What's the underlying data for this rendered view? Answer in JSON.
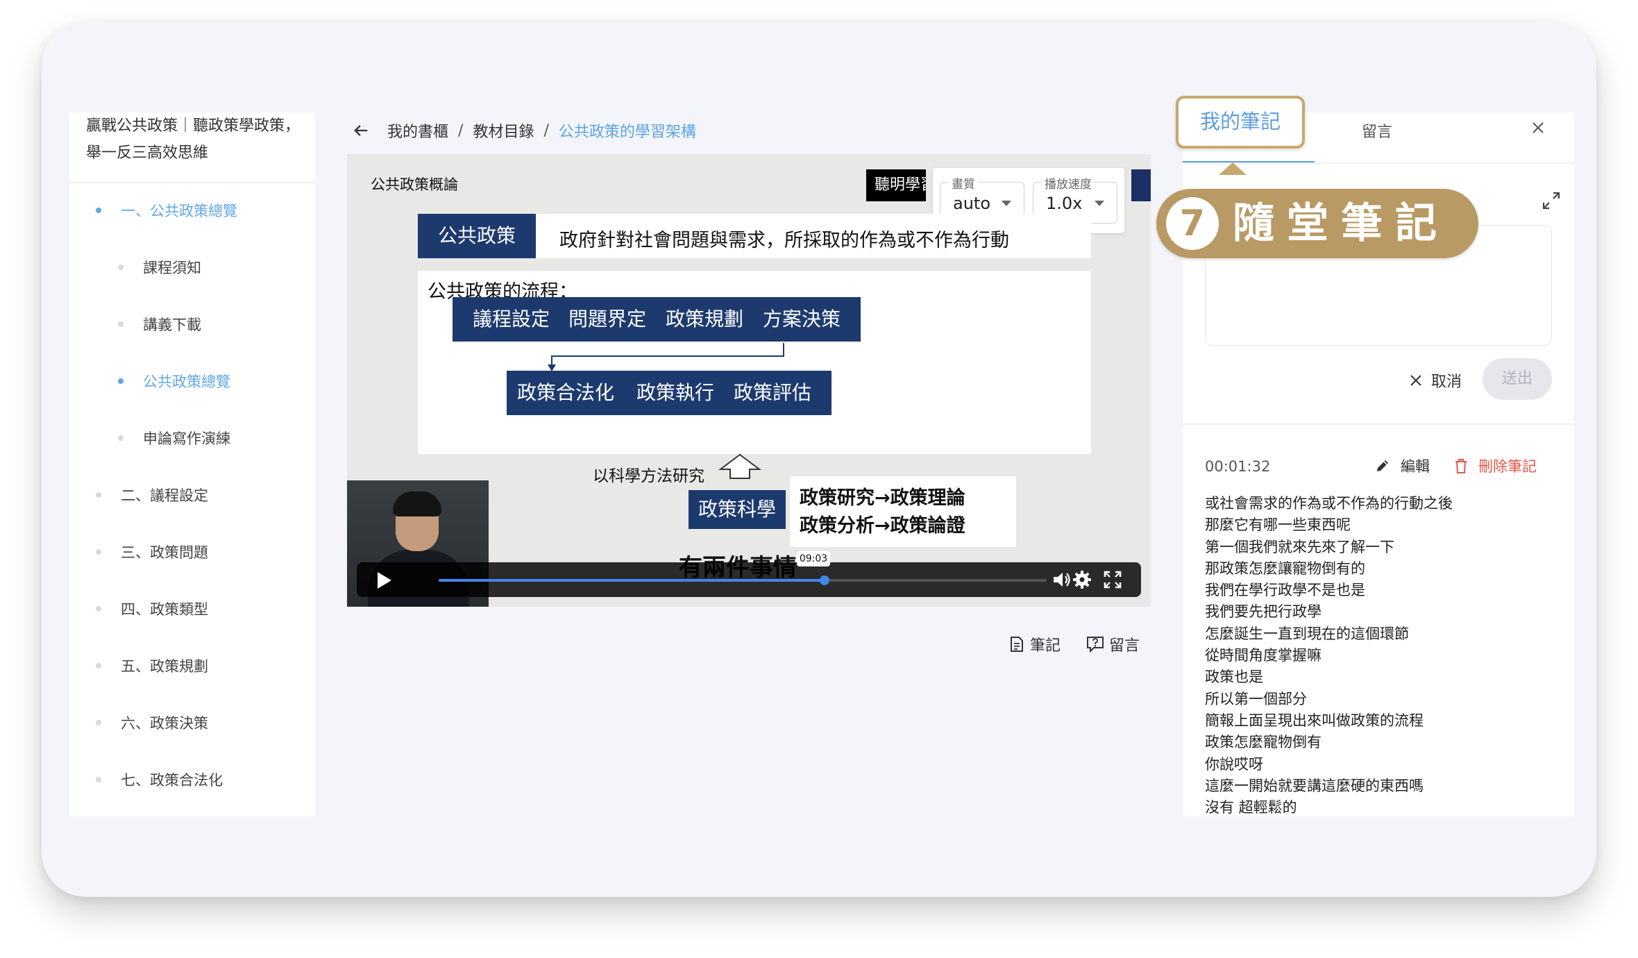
{
  "colors": {
    "accent": "#5b9ee0",
    "badge": "#b99a65",
    "navy": "#1c3a6e",
    "danger": "#e2574c"
  },
  "sidebar": {
    "course_title": "贏戰公共政策｜聽政策學政策，舉一反三高效思維",
    "items": [
      {
        "label": "一、公共政策總覽",
        "active": true
      },
      {
        "label": "課程須知"
      },
      {
        "label": "講義下載"
      },
      {
        "label": "公共政策總覽",
        "active": true
      },
      {
        "label": "申論寫作演練"
      },
      {
        "label": "二、議程設定"
      },
      {
        "label": "三、政策問題"
      },
      {
        "label": "四、政策類型"
      },
      {
        "label": "五、政策規劃"
      },
      {
        "label": "六、政策決策"
      },
      {
        "label": "七、政策合法化"
      }
    ]
  },
  "breadcrumb": {
    "items": [
      "我的書櫃",
      "教材目錄",
      "公共政策的學習架構"
    ],
    "separator": "/"
  },
  "video": {
    "slide_header": "公共政策概論",
    "brand": "聽明學習",
    "quality_label": "畫質",
    "quality_value": "auto",
    "speed_label": "播放速度",
    "speed_value": "1.0x",
    "pp_label": "公共政策",
    "pp_definition": "政府針對社會問題與需求，所採取的作為或不作為行動",
    "flow_title": "公共政策的流程：",
    "flow": [
      "議程設定",
      "問題界定",
      "政策規劃",
      "方案決策",
      "政策合法化",
      "政策執行",
      "政策評估"
    ],
    "research_label": "以科學方法研究",
    "science_box": "政策科學",
    "research_lines": [
      "政策研究→政策理論",
      "政策分析→政策論證"
    ],
    "caption": "有兩件事情",
    "time_tooltip": "09:03",
    "progress_fraction": 0.635
  },
  "video_actions": {
    "notes": "筆記",
    "comments": "留言"
  },
  "right_panel": {
    "tab_notes": "我的筆記",
    "tab_comments": "留言",
    "badge_number": "7",
    "badge_text": "隨堂筆記",
    "cancel": "取消",
    "send": "送出",
    "note_time": "00:01:32",
    "edit": "編輯",
    "delete": "刪除筆記",
    "note_lines": [
      "或社會需求的作為或不作為的行動之後",
      "那麼它有哪一些東西呢",
      "第一個我們就來先來了解一下",
      "那政策怎麼讓寵物倒有的",
      "我們在學行政學不是也是",
      "我們要先把行政學",
      "怎麼誕生一直到現在的這個環節",
      "從時間角度掌握嘛",
      "政策也是",
      "所以第一個部分",
      "簡報上面呈現出來叫做政策的流程",
      "政策怎麼寵物倒有",
      "你說哎呀",
      "這麼一開始就要講這麼硬的東西嗎",
      "沒有 超輕鬆的"
    ]
  }
}
